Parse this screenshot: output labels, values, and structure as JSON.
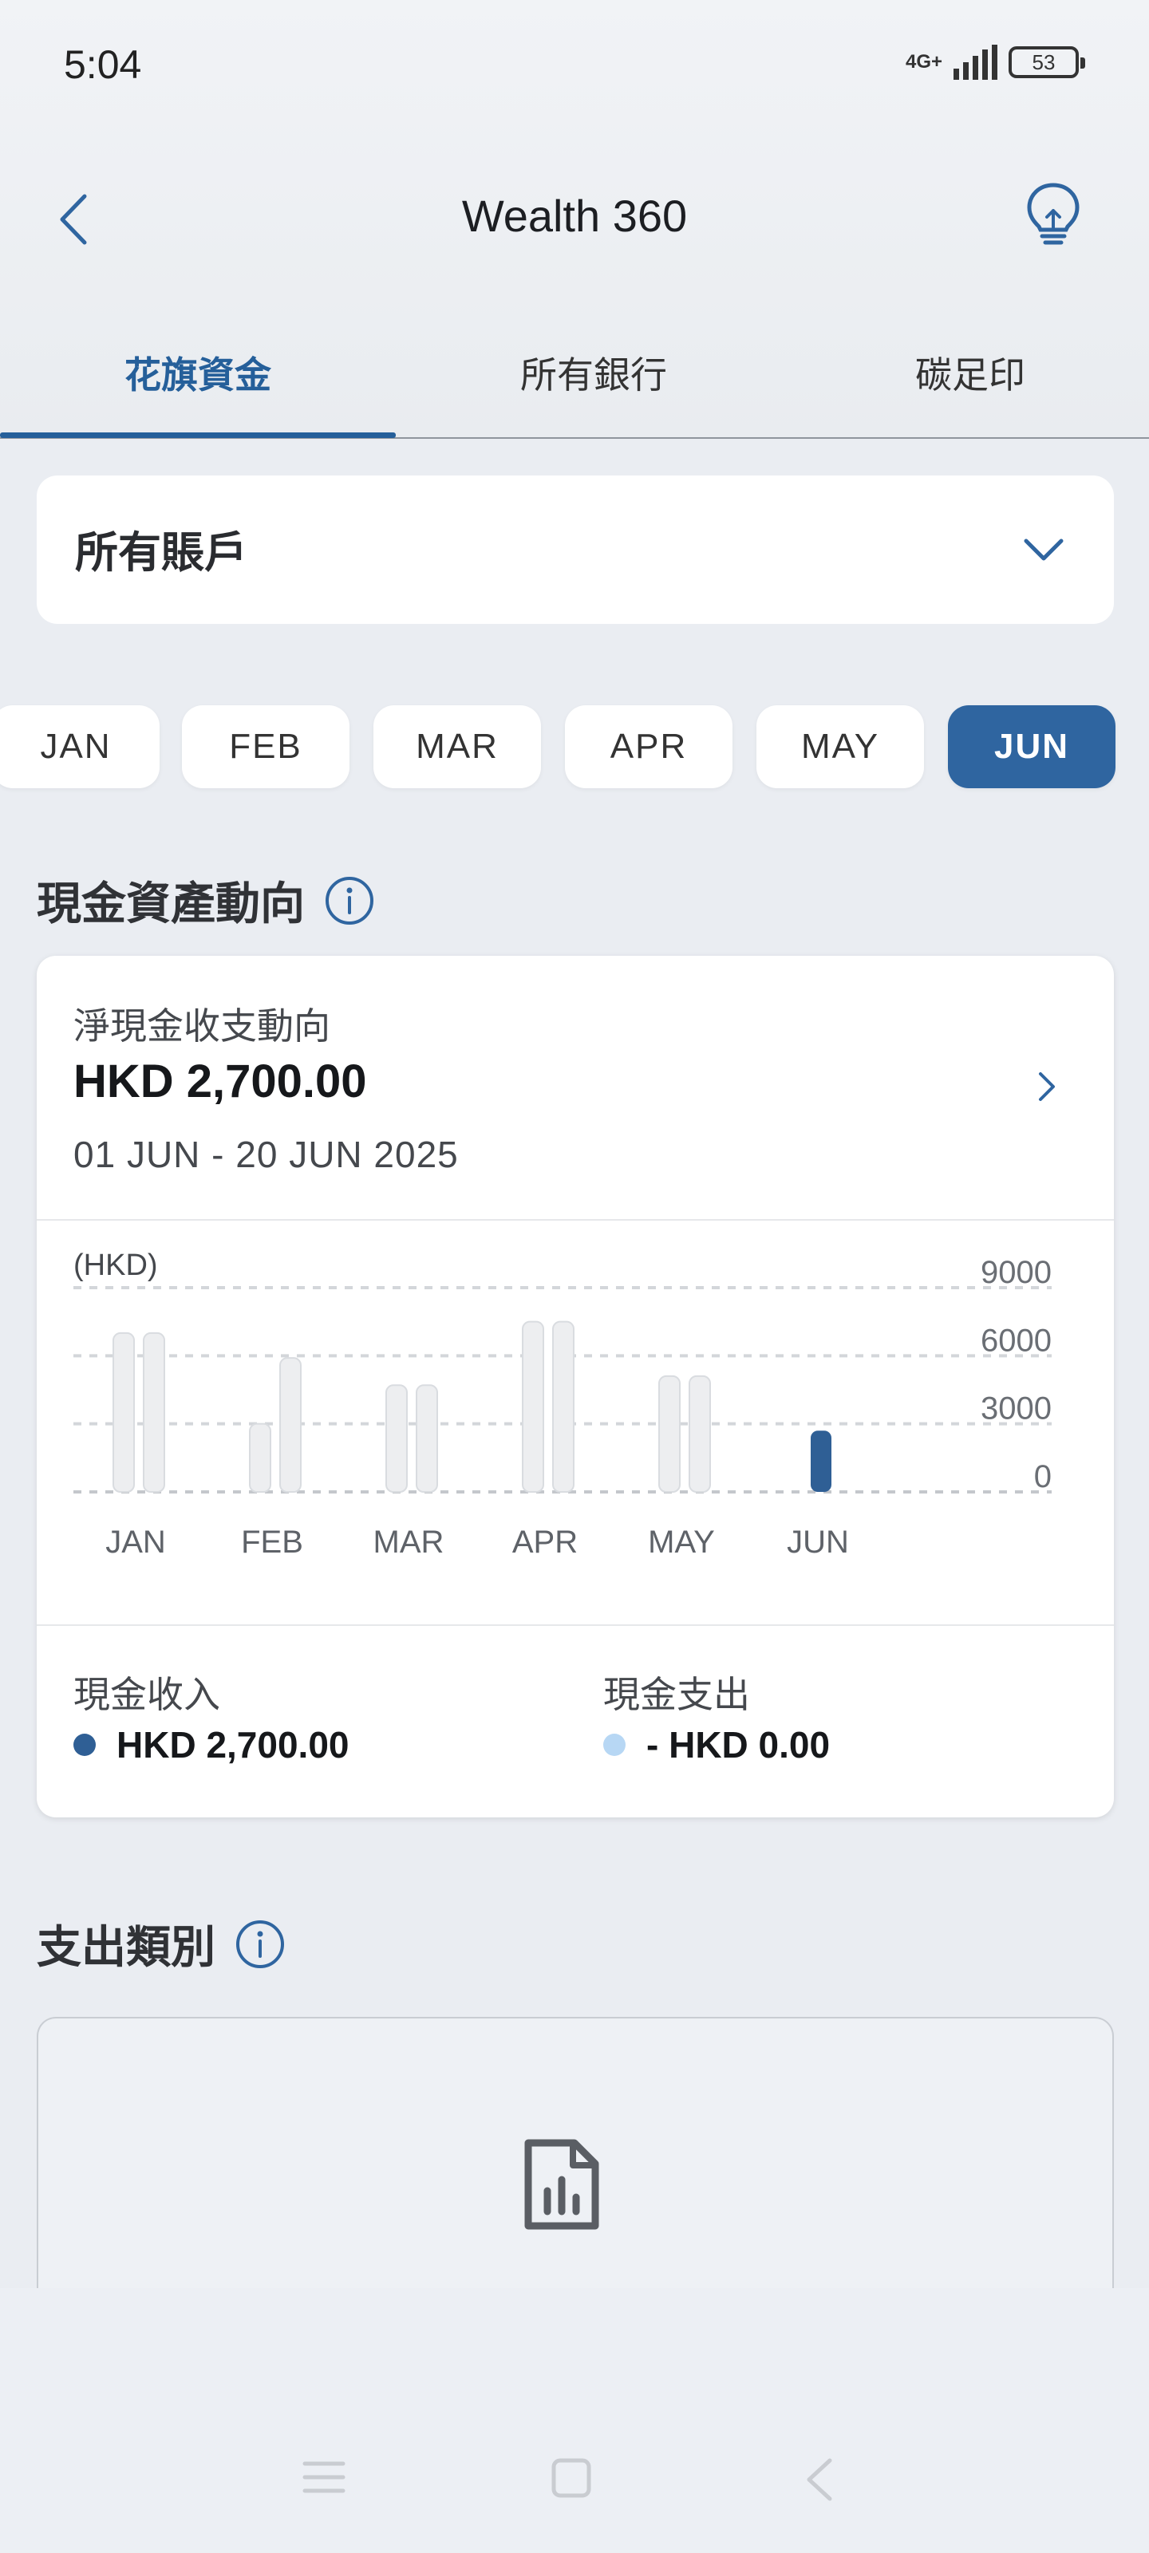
{
  "status_bar": {
    "time": "5:04",
    "network": "4G+",
    "battery": "53"
  },
  "header": {
    "title": "Wealth 360",
    "back_icon": "chevron-left-icon",
    "tip_icon": "lightbulb-icon"
  },
  "tabs": [
    {
      "label": "花旗資金",
      "active": true
    },
    {
      "label": "所有銀行",
      "active": false
    },
    {
      "label": "碳足印",
      "active": false
    }
  ],
  "account_selector": {
    "label": "所有賬戶",
    "icon": "chevron-down-icon"
  },
  "months": [
    {
      "label": "JAN",
      "active": false
    },
    {
      "label": "FEB",
      "active": false
    },
    {
      "label": "MAR",
      "active": false
    },
    {
      "label": "APR",
      "active": false
    },
    {
      "label": "MAY",
      "active": false
    },
    {
      "label": "JUN",
      "active": true
    }
  ],
  "cash_section": {
    "heading": "現金資產動向",
    "net_label": "淨現金收支動向",
    "net_amount": "HKD 2,700.00",
    "period": "01 JUN - 20 JUN 2025",
    "income_label": "現金收入",
    "income_value": "HKD 2,700.00",
    "expense_label": "現金支出",
    "expense_value": "- HKD 0.00"
  },
  "chart_data": {
    "type": "bar",
    "unit_label": "(HKD)",
    "categories": [
      "JAN",
      "FEB",
      "MAR",
      "APR",
      "MAY",
      "JUN"
    ],
    "series": [
      {
        "name": "現金收入",
        "values": [
          7000,
          3000,
          4700,
          7500,
          5100,
          2700
        ]
      },
      {
        "name": "現金支出",
        "values": [
          7000,
          5900,
          4700,
          7500,
          5100,
          0
        ]
      }
    ],
    "yticks": [
      0,
      3000,
      6000,
      9000
    ],
    "ylim": [
      0,
      9000
    ],
    "grid": true,
    "colors": {
      "income_active": "#2f5f95",
      "income_dot": "#2f5f95",
      "expense_dot": "#b7d7f4",
      "inactive": "#edeef0"
    }
  },
  "spending_section": {
    "heading": "支出類別",
    "icon": "report-chart-icon"
  },
  "nav_bar": {
    "menu_icon": "menu-icon",
    "home_icon": "home-square-icon",
    "back_icon": "back-triangle-icon"
  }
}
